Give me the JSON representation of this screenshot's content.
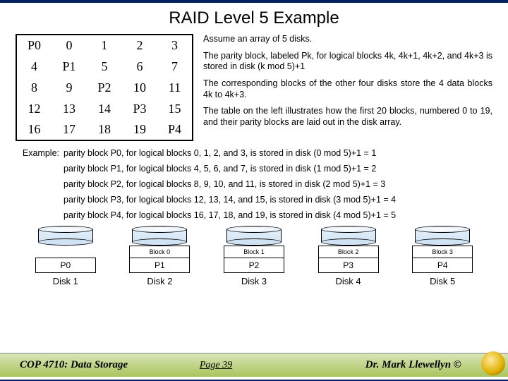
{
  "title": "RAID Level 5 Example",
  "table": {
    "rows": [
      [
        "P0",
        "0",
        "1",
        "2",
        "3"
      ],
      [
        "4",
        "P1",
        "5",
        "6",
        "7"
      ],
      [
        "8",
        "9",
        "P2",
        "10",
        "11"
      ],
      [
        "12",
        "13",
        "14",
        "P3",
        "15"
      ],
      [
        "16",
        "17",
        "18",
        "19",
        "P4"
      ]
    ]
  },
  "desc": {
    "p1": "Assume an array of 5 disks.",
    "p2": "The parity block, labeled Pk, for logical blocks 4k, 4k+1, 4k+2, and 4k+3 is stored in disk (k mod 5)+1",
    "p3": "The corresponding blocks of the other four disks store the 4 data blocks 4k to 4k+3.",
    "p4": "The table on the left illustrates how the first 20 blocks, numbered 0 to 19, and their parity blocks are laid out in the disk array."
  },
  "example": {
    "label": "Example:",
    "lines": [
      "parity block P0, for logical blocks 0, 1, 2, and 3, is stored in disk (0 mod 5)+1 = 1",
      "parity block P1, for logical blocks 4, 5, 6, and 7, is stored in disk (1 mod 5)+1 = 2",
      "parity block P2, for logical blocks 8, 9, 10, and 11, is stored in disk (2 mod 5)+1 = 3",
      "parity block P3, for logical blocks 12, 13, 14, and 15, is stored in disk (3 mod 5)+1 = 4",
      "parity block P4, for logical blocks 16, 17, 18, and 19, is stored in disk (4 mod 5)+1 = 5"
    ]
  },
  "disks": [
    {
      "block": "",
      "parity": "P0",
      "label": "Disk 1"
    },
    {
      "block": "Block 0",
      "parity": "P1",
      "label": "Disk 2"
    },
    {
      "block": "Block 1",
      "parity": "P2",
      "label": "Disk 3"
    },
    {
      "block": "Block 2",
      "parity": "P3",
      "label": "Disk 4"
    },
    {
      "block": "Block 3",
      "parity": "P4",
      "label": "Disk 5"
    }
  ],
  "footer": {
    "course": "COP 4710: Data Storage",
    "page": "Page 39",
    "author": "Dr. Mark Llewellyn ©"
  }
}
